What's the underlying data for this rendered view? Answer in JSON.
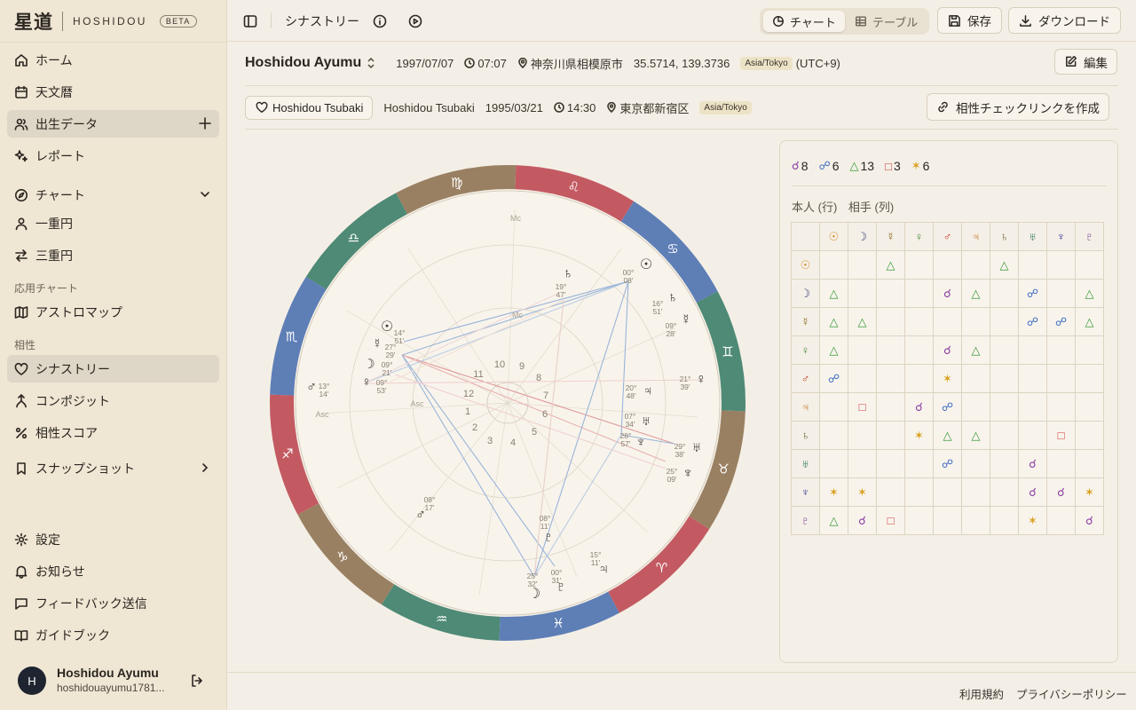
{
  "brand": {
    "kanji": "星道",
    "name": "HOSHIDOU",
    "badge": "BETA"
  },
  "sidebar": {
    "items": [
      {
        "label": "ホーム"
      },
      {
        "label": "天文暦"
      },
      {
        "label": "出生データ"
      },
      {
        "label": "レポート"
      },
      {
        "label": "チャート"
      },
      {
        "label": "一重円"
      },
      {
        "label": "三重円"
      },
      {
        "label": "アストロマップ"
      },
      {
        "label": "シナストリー"
      },
      {
        "label": "コンポジット"
      },
      {
        "label": "相性スコア"
      },
      {
        "label": "スナップショット"
      },
      {
        "label": "設定"
      },
      {
        "label": "お知らせ"
      },
      {
        "label": "フィードバック送信"
      },
      {
        "label": "ガイドブック"
      }
    ],
    "section_applied": "応用チャート",
    "section_compat": "相性"
  },
  "user": {
    "initial": "H",
    "name": "Hoshidou Ayumu",
    "email": "hoshidouayumu1781..."
  },
  "topbar": {
    "title": "シナストリー",
    "tab_chart": "チャート",
    "tab_table": "テーブル",
    "save": "保存",
    "download": "ダウンロード"
  },
  "person": {
    "name": "Hoshidou Ayumu",
    "date": "1997/07/07",
    "time": "07:07",
    "place": "神奈川県相模原市",
    "coords": "35.5714, 139.3736",
    "tz": "Asia/Tokyo",
    "offset": "(UTC+9)",
    "edit": "編集"
  },
  "partner": {
    "button": "Hoshidou Tsubaki",
    "name": "Hoshidou Tsubaki",
    "date": "1995/03/21",
    "time": "14:30",
    "place": "東京都新宿区",
    "tz": "Asia/Tokyo",
    "link_button": "相性チェックリンクを作成"
  },
  "wheel": {
    "mc_label": "Mc",
    "asc_label": "Asc",
    "houses": [
      "1",
      "2",
      "3",
      "4",
      "5",
      "6",
      "7",
      "8",
      "9",
      "10",
      "11",
      "12"
    ],
    "outer_planets": [
      {
        "glyph": "♄",
        "deg": "19°",
        "min": "47'"
      },
      {
        "glyph": "☉",
        "deg": "00°",
        "min": "08'"
      },
      {
        "glyph": "♄",
        "deg": "16°",
        "min": "51'"
      },
      {
        "glyph": "☿",
        "deg": "09°",
        "min": "28'"
      },
      {
        "glyph": "♀",
        "deg": "21°",
        "min": "39'"
      },
      {
        "glyph": "♅",
        "deg": "29°",
        "min": "38'"
      },
      {
        "glyph": "♆",
        "deg": "25°",
        "min": "09'"
      },
      {
        "glyph": "♃",
        "deg": "15°",
        "min": "11'"
      },
      {
        "glyph": "♇",
        "deg": "00°",
        "min": "31'"
      },
      {
        "glyph": "☽",
        "deg": "25°",
        "min": "32'"
      },
      {
        "glyph": "♂",
        "deg": "08°",
        "min": "17'"
      },
      {
        "glyph": "♂",
        "deg": "13°",
        "min": "14'"
      },
      {
        "glyph": "☉",
        "deg": "14°",
        "min": "51'"
      }
    ],
    "inner_planets": [
      {
        "glyph": "♃",
        "deg": "20°",
        "min": "48'"
      },
      {
        "glyph": "♅",
        "deg": "07°",
        "min": "34'"
      },
      {
        "glyph": "♆",
        "deg": "28°",
        "min": "57'"
      },
      {
        "glyph": "♇",
        "deg": "08°",
        "min": "11'"
      },
      {
        "glyph": "☿",
        "deg": "27°",
        "min": "29'"
      },
      {
        "glyph": "☽",
        "deg": "09°",
        "min": "21'"
      },
      {
        "glyph": "♀",
        "deg": "09°",
        "min": "53'"
      }
    ]
  },
  "aspects": {
    "conjunction": {
      "glyph": "☌",
      "count": "8"
    },
    "opposition": {
      "glyph": "☍",
      "count": "6"
    },
    "trine": {
      "glyph": "△",
      "count": "13"
    },
    "square": {
      "glyph": "□",
      "count": "3"
    },
    "sextile": {
      "glyph": "✶",
      "count": "6"
    },
    "row_label": "本人 (行)",
    "col_label": "相手 (列)",
    "planets": [
      "☉",
      "☽",
      "☿",
      "♀",
      "♂",
      "♃",
      "♄",
      "♅",
      "♆",
      "♇"
    ],
    "planet_colors": [
      "#d08a2c",
      "#3a3c78",
      "#8a6a1c",
      "#4a8a3a",
      "#c03a2a",
      "#c06a1a",
      "#6a5a2a",
      "#2a7a5a",
      "#3a3c9a",
      "#6a2a8a"
    ],
    "colors": {
      "conjunction": "#8a3aa0",
      "opposition": "#3a6ac0",
      "trine": "#3a9a3a",
      "square": "#d03a3a",
      "sextile": "#d9a020"
    },
    "matrix": [
      [
        "",
        "",
        "△",
        "",
        "",
        "",
        "△",
        "",
        "",
        ""
      ],
      [
        "△",
        "",
        "",
        "",
        "☌",
        "△",
        "",
        "☍",
        "",
        "△"
      ],
      [
        "△",
        "△",
        "",
        "",
        "",
        "",
        "",
        "☍",
        "☍",
        "△"
      ],
      [
        "△",
        "",
        "",
        "",
        "☌",
        "△",
        "",
        "",
        "",
        ""
      ],
      [
        "☍",
        "",
        "",
        "",
        "✶",
        "",
        "",
        "",
        "",
        ""
      ],
      [
        "",
        "□",
        "",
        "☌",
        "☍",
        "",
        "",
        "",
        "",
        ""
      ],
      [
        "",
        "",
        "",
        "✶",
        "△",
        "△",
        "",
        "",
        "□",
        ""
      ],
      [
        "",
        "",
        "",
        "",
        "☍",
        "",
        "",
        "☌",
        "",
        ""
      ],
      [
        "✶",
        "✶",
        "",
        "",
        "",
        "",
        "",
        "☌",
        "☌",
        "✶"
      ],
      [
        "△",
        "☌",
        "□",
        "",
        "",
        "",
        "",
        "✶",
        "",
        "☌"
      ]
    ]
  },
  "footer": {
    "terms": "利用規約",
    "privacy": "プライバシーポリシー"
  }
}
